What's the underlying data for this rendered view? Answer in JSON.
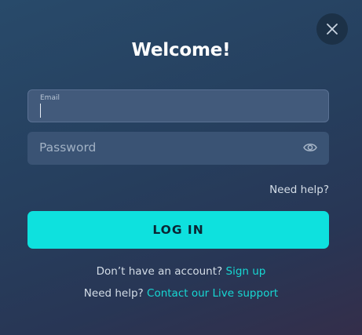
{
  "modal": {
    "title": "Welcome!",
    "close_icon": "close-icon"
  },
  "form": {
    "email": {
      "label": "Email",
      "value": "",
      "focused": true
    },
    "password": {
      "placeholder": "Password",
      "value": "",
      "toggle_icon": "eye-icon"
    },
    "need_help": "Need help?",
    "login_label": "LOG IN"
  },
  "footer": {
    "signup_prompt": "Don’t have an account?",
    "signup_link": "Sign up",
    "support_prompt": "Need help?",
    "support_link": "Contact our Live support"
  },
  "colors": {
    "accent": "#0ee1de",
    "link": "#17d8d3",
    "field_bg": "#3d5677"
  }
}
